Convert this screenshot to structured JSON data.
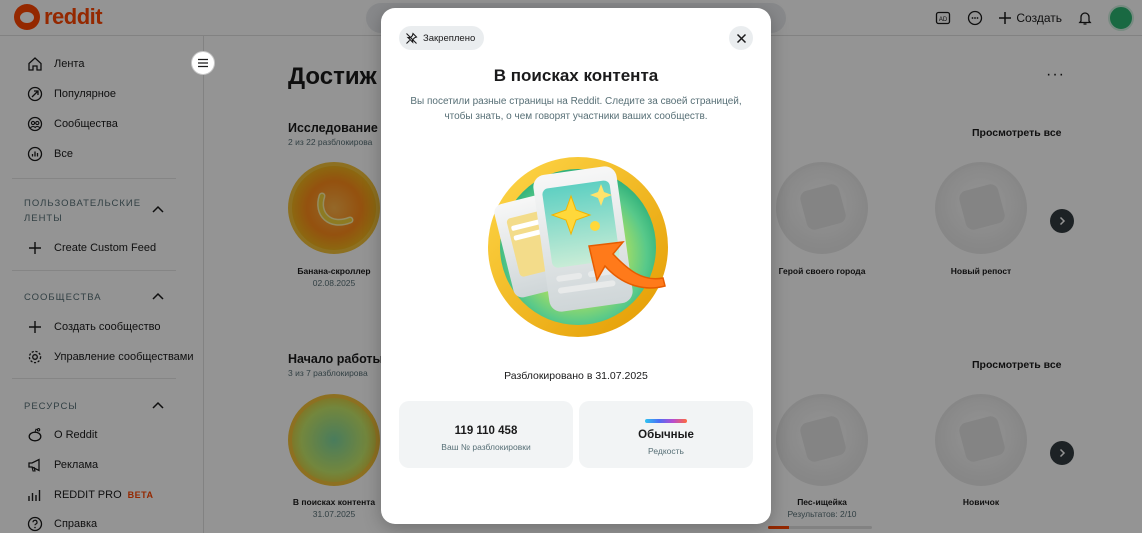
{
  "topbar": {
    "logo_text": "reddit",
    "create_label": "Создать",
    "icons": [
      "ad-icon",
      "chat-icon",
      "plus-icon",
      "bell-icon",
      "avatar"
    ]
  },
  "sidebar": {
    "main_items": [
      {
        "label": "Лента",
        "icon": "home-icon"
      },
      {
        "label": "Популярное",
        "icon": "popular-icon"
      },
      {
        "label": "Сообщества",
        "icon": "communities-icon"
      },
      {
        "label": "Все",
        "icon": "all-icon"
      }
    ],
    "custom_feeds": {
      "heading_line1": "ПОЛЬЗОВАТЕЛЬСКИЕ",
      "heading_line2": "ЛЕНТЫ",
      "create_label": "Create Custom Feed"
    },
    "communities": {
      "heading": "СООБЩЕСТВА",
      "create_label": "Создать сообщество",
      "manage_label": "Управление сообществами"
    },
    "resources": {
      "heading": "РЕСУРСЫ",
      "about_label": "О Reddit",
      "ads_label": "Реклама",
      "pro_label": "REDDIT PRO",
      "pro_badge": "BETA",
      "help_label": "Справка"
    }
  },
  "main": {
    "title": "Достиж",
    "sections": [
      {
        "title": "Исследование",
        "subtitle": "2 из 22 разблокирова",
        "view_all": "Просмотреть все",
        "badges": [
          {
            "name": "Банана-скроллер",
            "date": "02.08.2025"
          },
          {
            "name": "Герой своего города",
            "date": ""
          },
          {
            "name": "Новый репост",
            "date": ""
          }
        ]
      },
      {
        "title": "Начало работы",
        "subtitle": "3 из 7 разблокирова",
        "view_all": "Просмотреть все",
        "badges": [
          {
            "name": "В поисках контента",
            "date": "31.07.2025"
          },
          {
            "name": "Пес-ищейка",
            "date": "Результатов: 2/10"
          },
          {
            "name": "Новичок",
            "date": ""
          }
        ]
      }
    ],
    "carousel_progress": 0.2
  },
  "modal": {
    "pin_label": "Закреплено",
    "title": "В поисках контента",
    "description": "Вы посетили разные страницы на Reddit. Следите за своей страницей, чтобы знать, о чем говорят участники ваших сообществ.",
    "unlocked_text": "Разблокировано в 31.07.2025",
    "unlock_number": "119 110 458",
    "unlock_number_label": "Ваш № разблокировки",
    "rarity_value": "Обычные",
    "rarity_label": "Редкость"
  },
  "colors": {
    "brand": "#ff4500",
    "badge_gold": "#f3c23a",
    "badge_green": "#b9e35a",
    "overlay": "rgba(0,0,0,0.42)"
  }
}
